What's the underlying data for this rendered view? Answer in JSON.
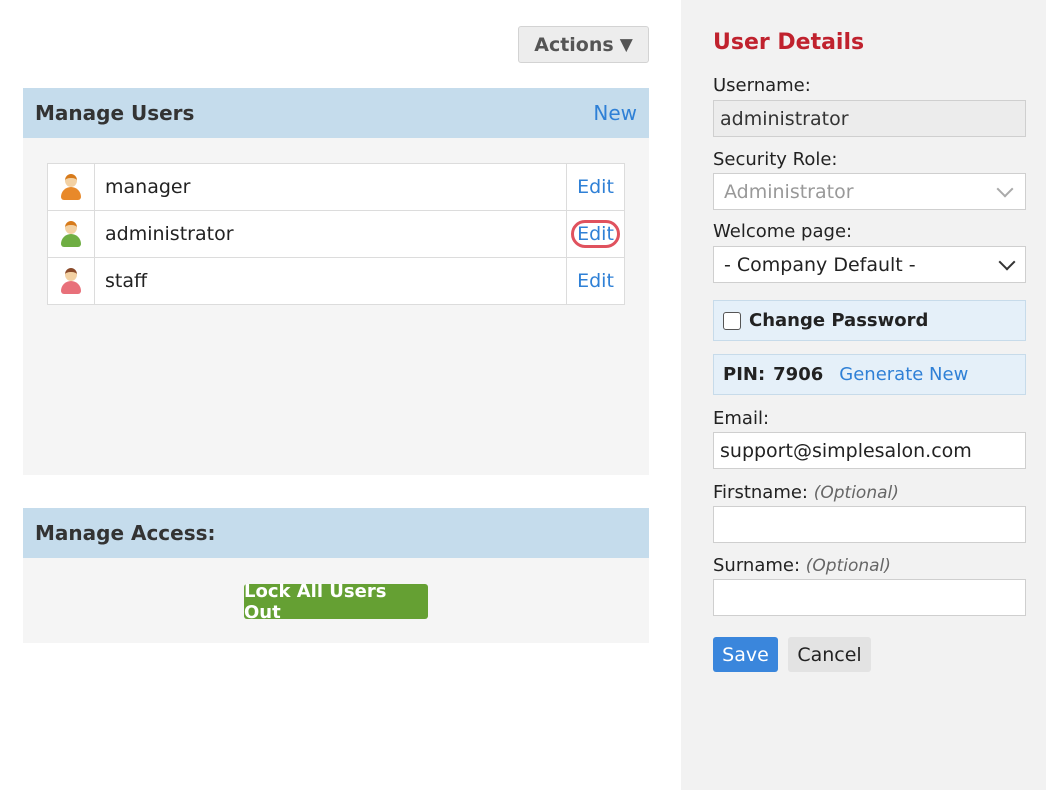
{
  "toolbar": {
    "actions_label": "Actions",
    "actions_caret": "▼"
  },
  "manage_users": {
    "title": "Manage Users",
    "new_label": "New",
    "users": [
      {
        "name": "manager",
        "edit_label": "Edit",
        "icon": "user-icon-orange",
        "icon_color": "#e8892a"
      },
      {
        "name": "administrator",
        "edit_label": "Edit",
        "icon": "user-icon-green",
        "icon_color": "#6fae43"
      },
      {
        "name": "staff",
        "edit_label": "Edit",
        "icon": "user-icon-pink",
        "icon_color": "#e8707a"
      }
    ]
  },
  "manage_access": {
    "title": "Manage Access:",
    "lock_label": "Lock All Users Out"
  },
  "user_details": {
    "title": "User Details",
    "username_label": "Username:",
    "username_value": "administrator",
    "role_label": "Security Role:",
    "role_value": "Administrator",
    "welcome_label": "Welcome page:",
    "welcome_value": "- Company Default -",
    "change_password_label": "Change Password",
    "pin_label": "PIN:",
    "pin_value": "7906",
    "generate_label": "Generate New",
    "email_label": "Email:",
    "email_value": "support@simplesalon.com",
    "firstname_label": "Firstname:",
    "firstname_optional": "(Optional)",
    "firstname_value": "",
    "surname_label": "Surname:",
    "surname_optional": "(Optional)",
    "surname_value": "",
    "save_label": "Save",
    "cancel_label": "Cancel"
  },
  "colors": {
    "header_bg": "#c5dcec",
    "link": "#2f80d6",
    "title_red": "#c0222e",
    "lock_green": "#65a033",
    "save_blue": "#3a86dc",
    "highlight_ring": "#e0525e"
  }
}
